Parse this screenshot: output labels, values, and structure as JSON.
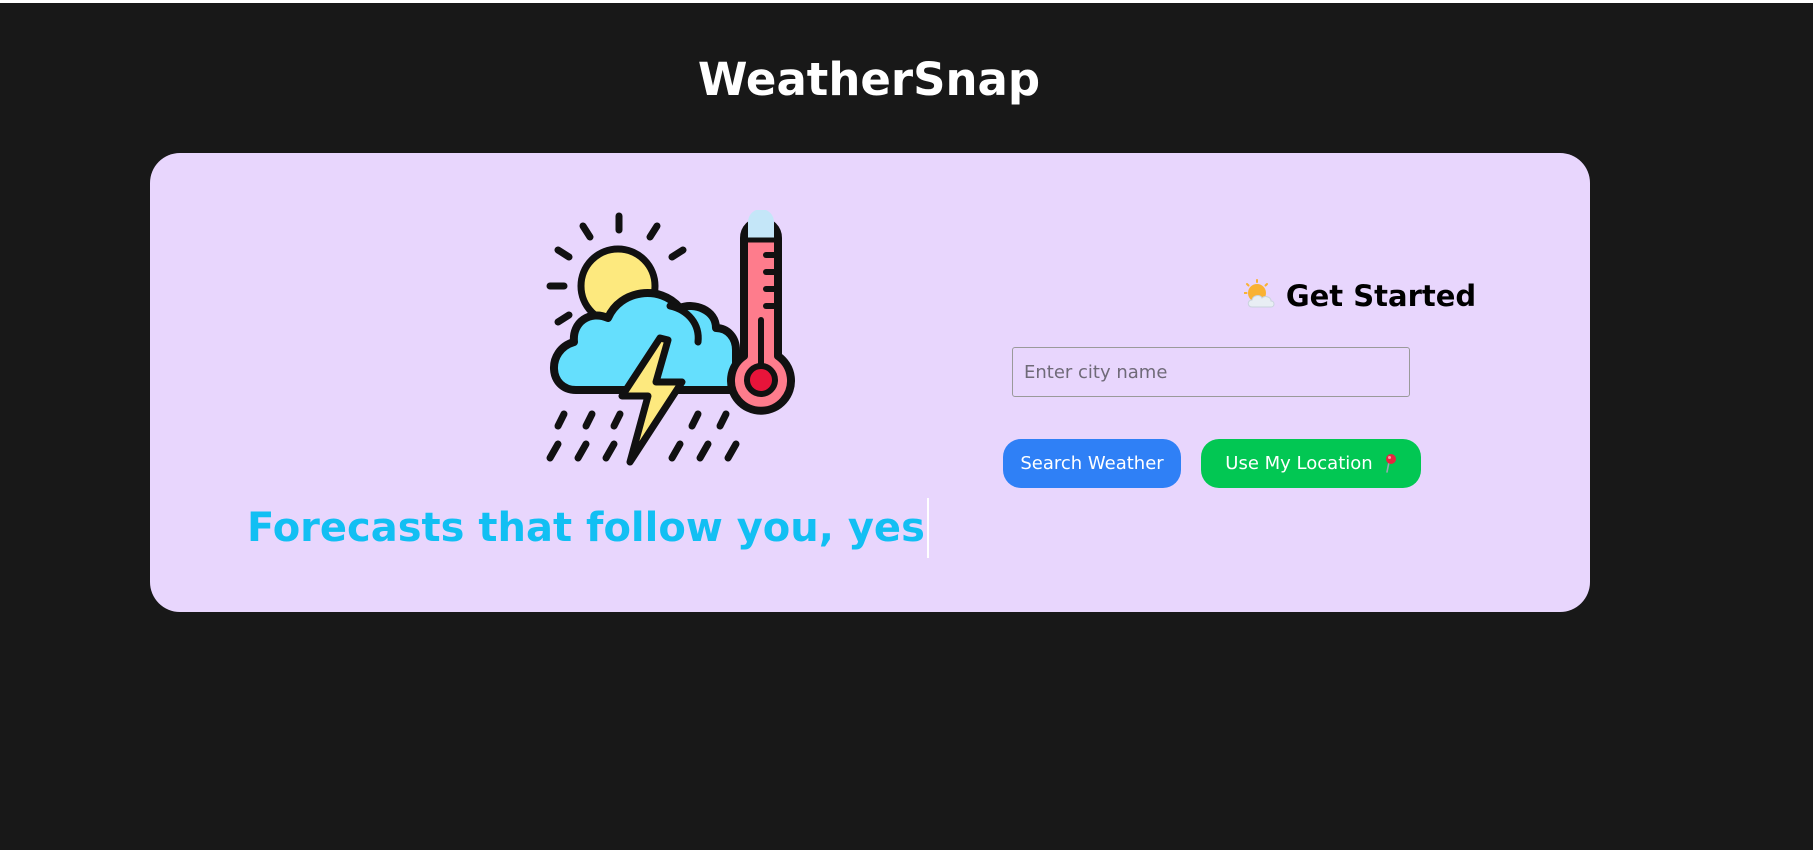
{
  "app": {
    "title": "WeatherSnap"
  },
  "hero": {
    "tagline": "Forecasts that follow you, yes",
    "illustration_icon": "weather-storm-thermometer-icon"
  },
  "search_panel": {
    "heading": "Get Started",
    "heading_icon": "sun-behind-cloud-icon",
    "city_input": {
      "value": "",
      "placeholder": "Enter city name"
    },
    "search_button_label": "Search Weather",
    "location_button_label": "Use My Location",
    "location_button_icon": "round-pushpin-icon"
  },
  "colors": {
    "page_background": "#181818",
    "card_background": "#e8d6fd",
    "tagline": "#12bff3",
    "search_button": "#2f80f6",
    "location_button": "#02c753"
  }
}
